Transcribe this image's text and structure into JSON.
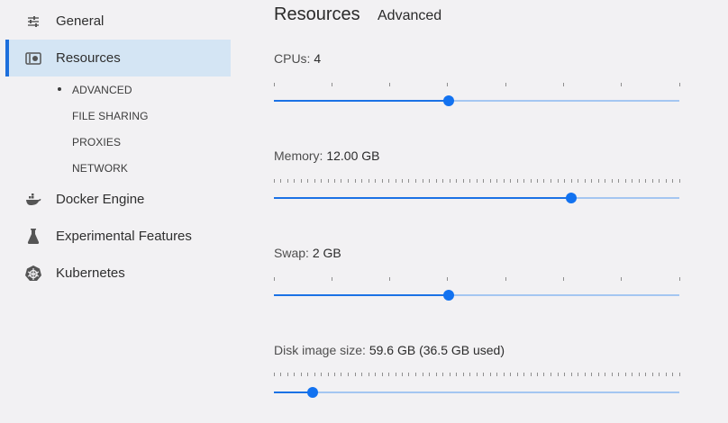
{
  "sidebar": {
    "items": [
      {
        "id": "general",
        "label": "General",
        "icon": "sliders-icon"
      },
      {
        "id": "resources",
        "label": "Resources",
        "icon": "resources-icon",
        "active": true
      },
      {
        "id": "docker-engine",
        "label": "Docker Engine",
        "icon": "whale-icon"
      },
      {
        "id": "experimental",
        "label": "Experimental Features",
        "icon": "flask-icon"
      },
      {
        "id": "kubernetes",
        "label": "Kubernetes",
        "icon": "helm-icon"
      }
    ],
    "subitems": [
      {
        "label": "ADVANCED",
        "active": true
      },
      {
        "label": "FILE SHARING"
      },
      {
        "label": "PROXIES"
      },
      {
        "label": "NETWORK"
      }
    ]
  },
  "header": {
    "title": "Resources",
    "subtitle": "Advanced"
  },
  "settings": {
    "cpus": {
      "label": "CPUs: ",
      "value": "4",
      "fraction": 0.43,
      "ticks": 8
    },
    "memory": {
      "label": "Memory: ",
      "value": "12.00 GB",
      "fraction": 0.733,
      "ticks": 61
    },
    "swap": {
      "label": "Swap: ",
      "value": "2 GB",
      "fraction": 0.43,
      "ticks": 8
    },
    "disk": {
      "label": "Disk image size: ",
      "value": "59.6 GB (36.5 GB used)",
      "fraction": 0.096,
      "ticks": 61
    }
  },
  "colors": {
    "accent": "#1272f0",
    "track": "#a4c6f1",
    "sidebar_active_bg": "#d4e5f4",
    "background": "#f2f1f3"
  }
}
